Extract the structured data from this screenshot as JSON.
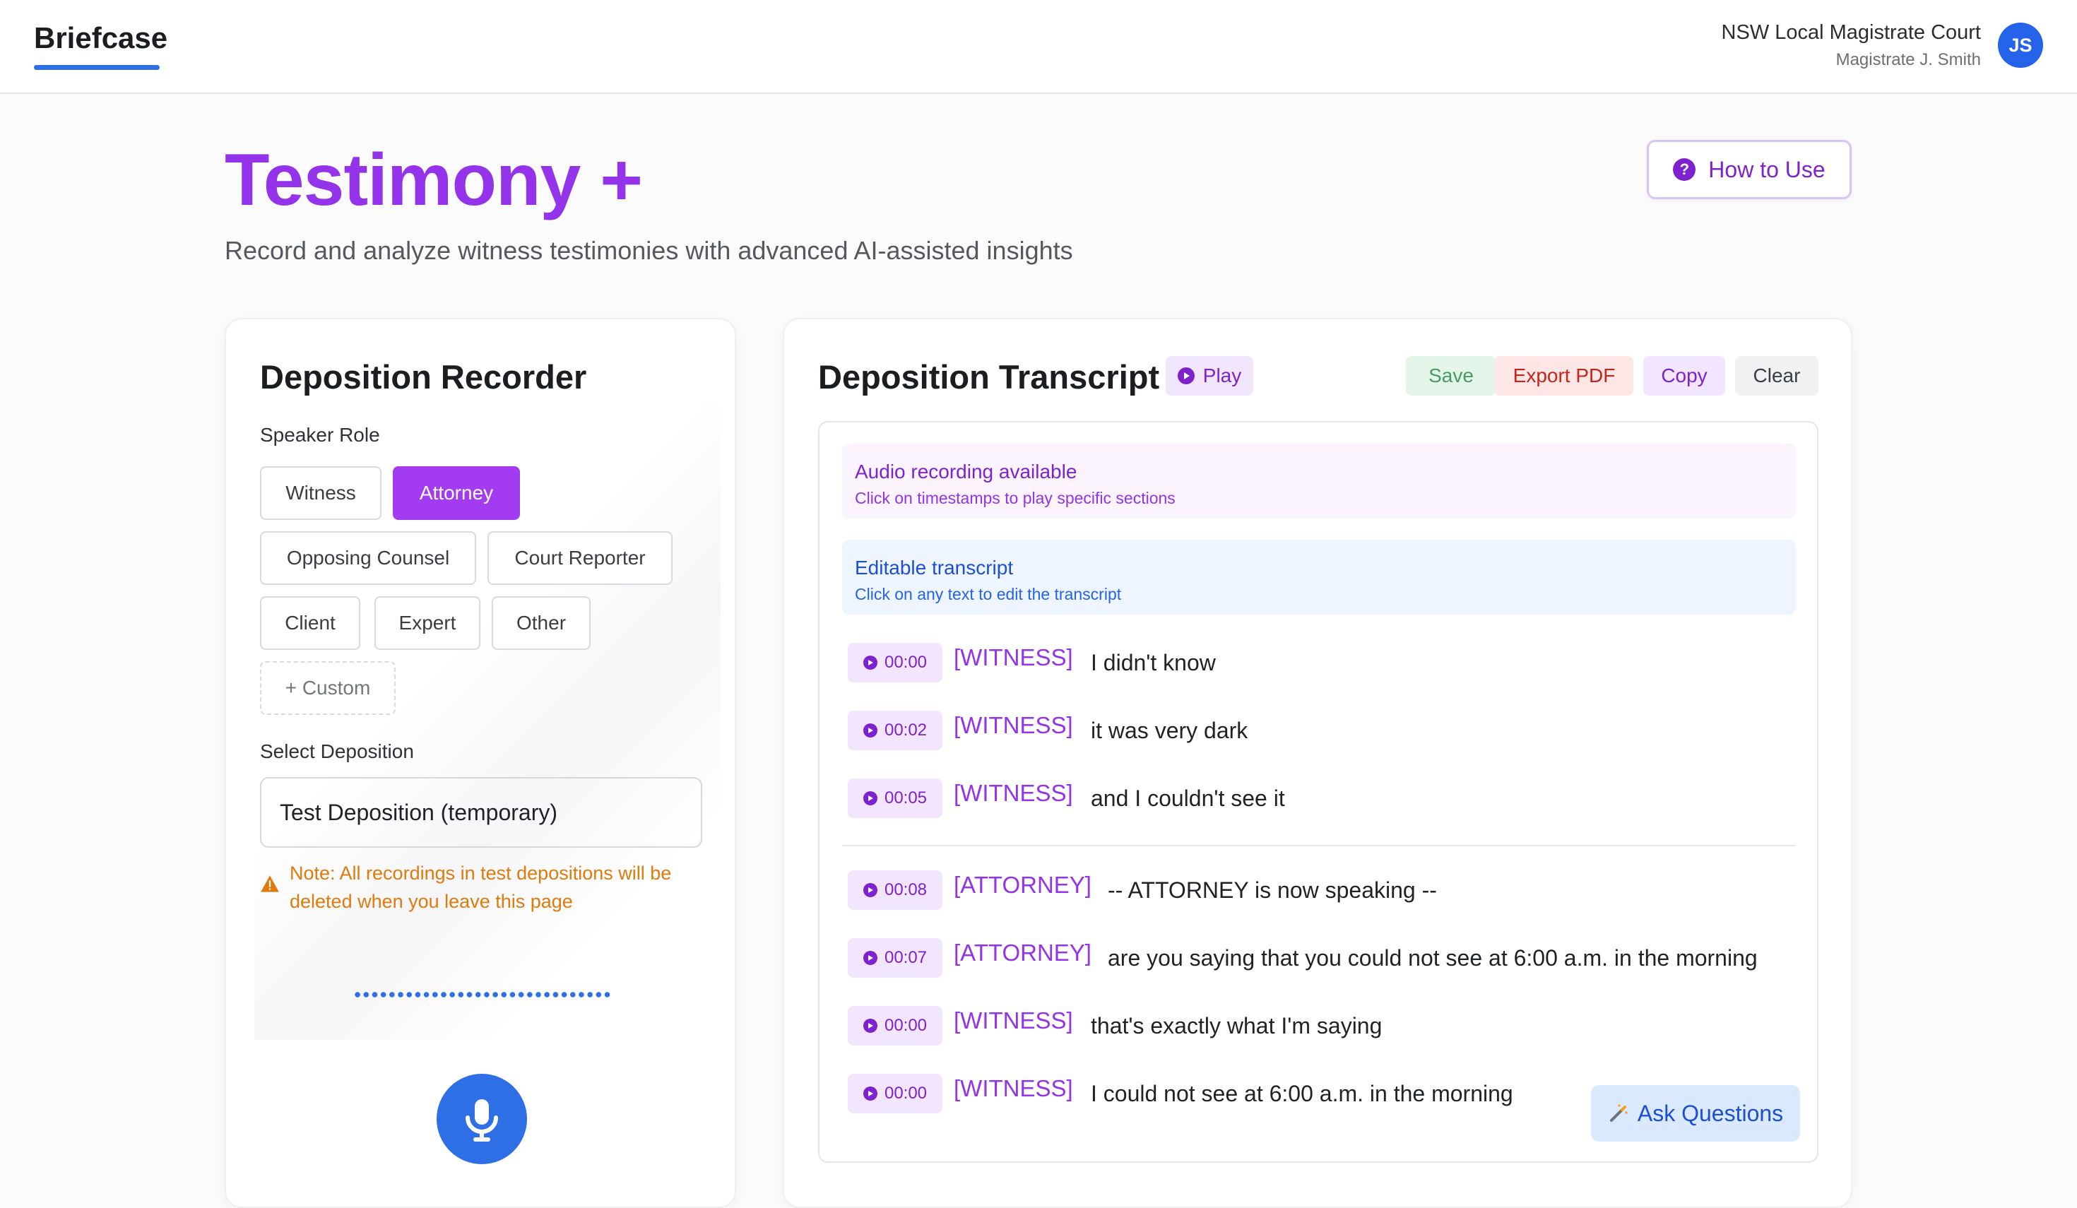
{
  "nav": {
    "brand": "Briefcase",
    "court_name": "NSW Local Magistrate Court",
    "judge_name": "Magistrate J. Smith",
    "avatar_initials": "JS"
  },
  "header": {
    "title": "Testimony +",
    "subtitle": "Record and analyze witness testimonies with advanced AI-assisted insights",
    "how_to_use_label": "How to Use"
  },
  "recorder": {
    "title": "Deposition Recorder",
    "speaker_role_label": "Speaker Role",
    "roles": [
      {
        "label": "Witness",
        "active": false
      },
      {
        "label": "Attorney",
        "active": true
      },
      {
        "label": "Opposing Counsel",
        "active": false
      },
      {
        "label": "Court Reporter",
        "active": false
      },
      {
        "label": "Client",
        "active": false
      },
      {
        "label": "Expert",
        "active": false
      },
      {
        "label": "Other",
        "active": false
      }
    ],
    "custom_label": "+ Custom",
    "select_label": "Select Deposition",
    "selected_deposition": "Test Deposition (temporary)",
    "note": "Note: All recordings in test depositions will be deleted when you leave this page"
  },
  "transcript": {
    "title": "Deposition Transcript",
    "play_label": "Play",
    "save_label": "Save",
    "export_label": "Export PDF",
    "copy_label": "Copy",
    "clear_label": "Clear",
    "audio_info": {
      "title": "Audio recording available",
      "subtitle": "Click on timestamps to play specific sections"
    },
    "edit_info": {
      "title": "Editable transcript",
      "subtitle": "Click on any text to edit the transcript"
    },
    "entries": [
      {
        "time": "00:00",
        "speaker": "[WITNESS]",
        "text": "I didn't know"
      },
      {
        "time": "00:02",
        "speaker": "[WITNESS]",
        "text": "it was very dark"
      },
      {
        "time": "00:05",
        "speaker": "[WITNESS]",
        "text": "and I couldn't see it"
      },
      {
        "time": "00:08",
        "speaker": "[ATTORNEY]",
        "text": "-- ATTORNEY is now speaking --"
      },
      {
        "time": "00:07",
        "speaker": "[ATTORNEY]",
        "text": "are you saying that you could not see at 6:00 a.m. in the morning"
      },
      {
        "time": "00:00",
        "speaker": "[WITNESS]",
        "text": "that's exactly what I'm saying"
      },
      {
        "time": "00:00",
        "speaker": "[WITNESS]",
        "text": "I could not see at 6:00 a.m. in the morning"
      }
    ],
    "ask_label": "Ask Questions"
  },
  "colors": {
    "accent_purple": "#9333ea",
    "primary_blue": "#2f6fe6",
    "warning_orange": "#e07a0b"
  }
}
